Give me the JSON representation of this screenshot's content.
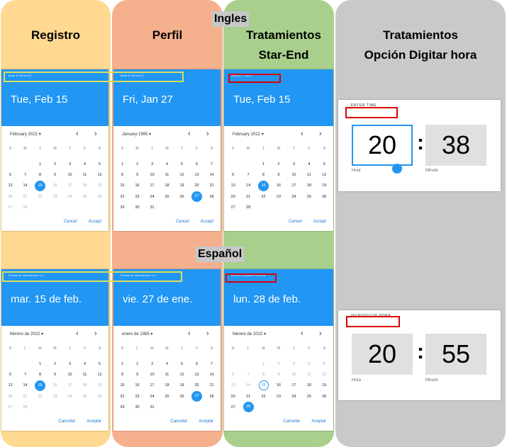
{
  "columns": [
    {
      "title": "Registro"
    },
    {
      "title": "Perfil"
    },
    {
      "title": "Tratamientos\nStar-End"
    },
    {
      "title": "Tratamientos\nOpción Digitar hora"
    }
  ],
  "sections": {
    "english": "Ingles",
    "spanish": "Español"
  },
  "pickers": {
    "en_registro": {
      "label": "Date of Birth (*)",
      "date": "Tue, Feb 15",
      "month": "February 2022",
      "weekdays": [
        "S",
        "M",
        "T",
        "W",
        "T",
        "F",
        "S"
      ],
      "cancel": "Cancel",
      "accept": "Accept"
    },
    "en_perfil": {
      "label": "Date of Birth (*)",
      "date": "Fri, Jan 27",
      "month": "January 1995",
      "weekdays": [
        "S",
        "M",
        "T",
        "W",
        "T",
        "F",
        "S"
      ],
      "cancel": "Cancel",
      "accept": "Accept"
    },
    "en_trat": {
      "label": "SELECT DATE",
      "date": "Tue, Feb 15",
      "month": "February 2022",
      "weekdays": [
        "S",
        "M",
        "T",
        "W",
        "T",
        "F",
        "S"
      ],
      "cancel": "Cancel",
      "accept": "Accept"
    },
    "es_registro": {
      "label": "Fecha de Nacimiento (*)",
      "date": "mar. 15 de feb.",
      "month": "febrero de 2022",
      "weekdays": [
        "D",
        "L",
        "M",
        "M",
        "J",
        "V",
        "S"
      ],
      "cancel": "Cancelar",
      "accept": "Aceptar"
    },
    "es_perfil": {
      "label": "Fecha de Nacimiento (*)",
      "date": "vie. 27 de ene.",
      "month": "enero de 1995",
      "weekdays": [
        "D",
        "L",
        "M",
        "M",
        "J",
        "V",
        "S"
      ],
      "cancel": "Cancelar",
      "accept": "Aceptar"
    },
    "es_trat": {
      "label": "SELECCIONAR FECHA",
      "date": "lun. 28 de feb.",
      "month": "febrero de 2022",
      "weekdays": [
        "D",
        "L",
        "M",
        "M",
        "J",
        "V",
        "S"
      ],
      "cancel": "Cancelar",
      "accept": "Aceptar"
    }
  },
  "time_en": {
    "label": "ENTER TIME",
    "hour": "20",
    "minute": "38",
    "hour_caption": "Hour",
    "minute_caption": "Minute"
  },
  "time_es": {
    "label": "INTRODUCIR HORA",
    "hour": "20",
    "minute": "55",
    "hour_caption": "Hora",
    "minute_caption": "Minuto"
  },
  "icons": {
    "prev": "chevron-left-icon",
    "next": "chevron-right-icon",
    "dropdown": "caret-down-icon"
  },
  "colors": {
    "accent": "#2196f3",
    "yellow_col": "#ffd991",
    "orange_col": "#f5b08e",
    "green_col": "#a8d08c",
    "gray_col": "#c9c9c9",
    "highlight_red": "#dd0000",
    "highlight_yellow": "#d9e05a"
  }
}
